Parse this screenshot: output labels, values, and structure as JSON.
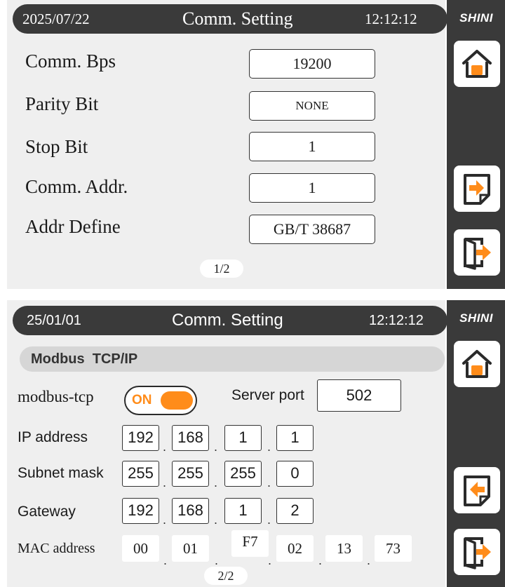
{
  "brand": "SHINI",
  "screen1": {
    "date": "2025/07/22",
    "title": "Comm. Setting",
    "time": "12:12:12",
    "rows": [
      {
        "label": "Comm. Bps",
        "value": "19200"
      },
      {
        "label": "Parity Bit",
        "value": "NONE"
      },
      {
        "label": "Stop Bit",
        "value": "1"
      },
      {
        "label": "Comm. Addr.",
        "value": "1"
      },
      {
        "label": "Addr Define",
        "value": "GB/T 38687"
      }
    ],
    "page": "1/2"
  },
  "screen2": {
    "date": "25/01/01",
    "title": "Comm. Setting",
    "time": "12:12:12",
    "section": "Modbus  TCP/IP",
    "modbus_label": "modbus-tcp",
    "toggle_text": "ON",
    "toggle_state": "on",
    "server_port_label": "Server port",
    "server_port": "502",
    "ip_label": "IP address",
    "ip": [
      "192",
      "168",
      "1",
      "1"
    ],
    "subnet_label": "Subnet mask",
    "subnet": [
      "255",
      "255",
      "255",
      "0"
    ],
    "gateway_label": "Gateway",
    "gateway": [
      "192",
      "168",
      "1",
      "2"
    ],
    "mac_label": "MAC address",
    "mac": [
      "00",
      "01",
      "F7",
      "02",
      "13",
      "73"
    ],
    "page": "2/2"
  },
  "sidebar": {
    "home_icon": "home-icon",
    "next_icon": "next-page-icon",
    "prev_icon": "previous-page-icon",
    "exit_icon": "exit-icon"
  },
  "colors": {
    "accent": "#ff8c1a",
    "dark": "#3a3a3a",
    "panel": "#efefef"
  }
}
